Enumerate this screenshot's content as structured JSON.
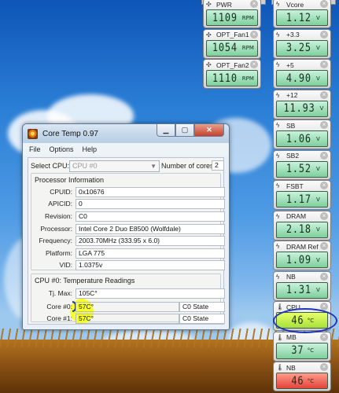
{
  "window": {
    "title": "Core Temp 0.97",
    "menu": [
      "File",
      "Options",
      "Help"
    ],
    "select_cpu_label": "Select CPU:",
    "select_cpu_value": "CPU #0",
    "cores_label": "Number of cores",
    "cores_value": "2"
  },
  "processor": {
    "section_title": "Processor Information",
    "fields": [
      {
        "label": "CPUID:",
        "value": "0x10676"
      },
      {
        "label": "APICID:",
        "value": "0"
      },
      {
        "label": "Revision:",
        "value": "C0"
      },
      {
        "label": "Processor:",
        "value": "Intel Core 2 Duo E8500 (Wolfdale)"
      },
      {
        "label": "Frequency:",
        "value": "2003.70MHz (333.95 x 6.0)"
      },
      {
        "label": "Platform:",
        "value": "LGA 775"
      },
      {
        "label": "VID:",
        "value": "1.0375v"
      }
    ]
  },
  "temps": {
    "section_title": "CPU #0: Temperature Readings",
    "tj_label": "Tj. Max:",
    "tj_value": "105C°",
    "cores": [
      {
        "label": "Core #0:",
        "value": "57C°",
        "state": "C0 State"
      },
      {
        "label": "Core #1:",
        "value": "57C°",
        "state": "C0 State"
      }
    ]
  },
  "gadgets_left": [
    {
      "label": "PWR",
      "value": "1109",
      "unit": "RPM",
      "icon": "fan-icon"
    },
    {
      "label": "OPT_Fan1",
      "value": "1054",
      "unit": "RPM",
      "icon": "fan-icon"
    },
    {
      "label": "OPT_Fan2",
      "value": "1110",
      "unit": "RPM",
      "icon": "fan-icon"
    }
  ],
  "gadgets_right": [
    {
      "label": "Vcore",
      "value": "1.12",
      "unit": "V",
      "icon": "voltage-icon"
    },
    {
      "label": "+3.3",
      "value": "3.25",
      "unit": "V",
      "icon": "voltage-icon"
    },
    {
      "label": "+5",
      "value": "4.90",
      "unit": "V",
      "icon": "voltage-icon"
    },
    {
      "label": "+12",
      "value": "11.93",
      "unit": "V",
      "icon": "voltage-icon"
    },
    {
      "label": "SB",
      "value": "1.06",
      "unit": "V",
      "icon": "voltage-icon"
    },
    {
      "label": "SB2",
      "value": "1.52",
      "unit": "V",
      "icon": "voltage-icon"
    },
    {
      "label": "FSBT",
      "value": "1.17",
      "unit": "V",
      "icon": "voltage-icon"
    },
    {
      "label": "DRAM",
      "value": "2.18",
      "unit": "V",
      "icon": "voltage-icon"
    },
    {
      "label": "DRAM Ref",
      "value": "1.09",
      "unit": "V",
      "icon": "voltage-icon"
    },
    {
      "label": "NB",
      "value": "1.31",
      "unit": "V",
      "icon": "voltage-icon"
    },
    {
      "label": "CPU",
      "value": "46",
      "unit": "°C",
      "icon": "thermometer-icon"
    },
    {
      "label": "MB",
      "value": "37",
      "unit": "°C",
      "icon": "thermometer-icon"
    },
    {
      "label": "NB",
      "value": "46",
      "unit": "°C",
      "icon": "thermometer-icon"
    }
  ],
  "colors": {
    "lcd_green": "#7fcf9c",
    "lcd_red": "#e4433a",
    "highlight_yellow": "#f5ff19",
    "pen_blue": "#1d36b8"
  }
}
